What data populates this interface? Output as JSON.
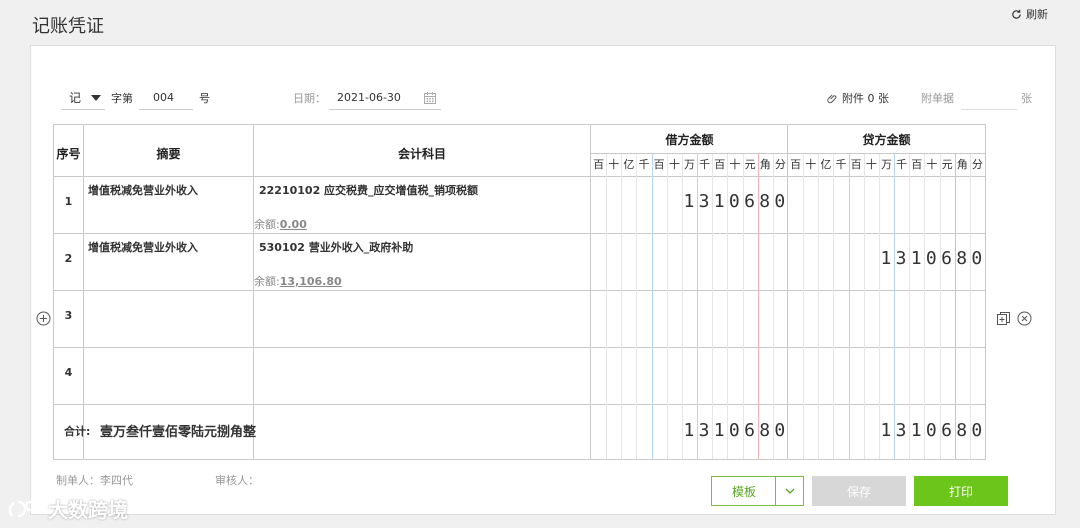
{
  "header": {
    "title": "记账凭证",
    "refresh_label": "刷新"
  },
  "meta": {
    "voucher_word": "记",
    "zi_label": "字第",
    "voucher_number": "004",
    "hao_label": "号",
    "date_label": "日期：",
    "date_value": "2021-06-30",
    "attachment_label": "附件 0 张",
    "bill_label": "附单据",
    "bill_value": "",
    "zhang_label": "张"
  },
  "table": {
    "headers": {
      "index": "序号",
      "summary": "摘要",
      "subject": "会计科目",
      "debit": "借方金额",
      "credit": "贷方金额"
    },
    "units": [
      "百",
      "十",
      "亿",
      "千",
      "百",
      "十",
      "万",
      "千",
      "百",
      "十",
      "元",
      "角",
      "分"
    ],
    "rows": [
      {
        "index": "1",
        "summary": "增值税减免营业外收入",
        "subject": "22210102 应交税费_应交增值税_销项税额",
        "balance_label": "余额:",
        "balance_value": "0.00",
        "debit": "1310680",
        "credit": ""
      },
      {
        "index": "2",
        "summary": "增值税减免营业外收入",
        "subject": "530102 营业外收入_政府补助",
        "balance_label": "余额:",
        "balance_value": "13,106.80",
        "debit": "",
        "credit": "1310680"
      },
      {
        "index": "3",
        "summary": "",
        "subject": "",
        "balance_label": "",
        "balance_value": "",
        "debit": "",
        "credit": ""
      },
      {
        "index": "4",
        "summary": "",
        "subject": "",
        "balance_label": "",
        "balance_value": "",
        "debit": "",
        "credit": ""
      }
    ],
    "total": {
      "label": "合计:",
      "amount_text": "壹万叁仟壹佰零陆元捌角整",
      "debit": "1310680",
      "credit": "1310680"
    }
  },
  "footer": {
    "maker_label": "制单人：李四代",
    "reviewer_label": "审核人：",
    "template_button": "模板",
    "save_button": "保存",
    "print_button": "打印"
  },
  "watermark": {
    "text": "大数跨境"
  },
  "colors": {
    "accent": "#6cc51b",
    "grid_blue": "#b8d4ee",
    "grid_red": "#f0b4b4",
    "border": "#c9c9c9"
  }
}
